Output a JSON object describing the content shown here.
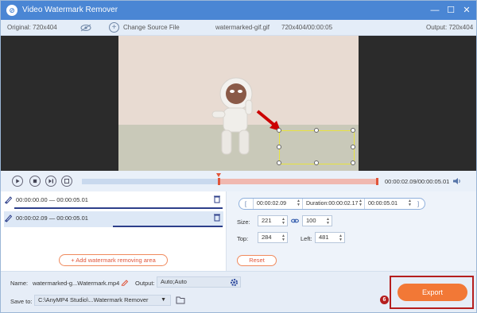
{
  "app": {
    "title": "Video Watermark Remover"
  },
  "infobar": {
    "original": "Original: 720x404",
    "change_source": "Change Source File",
    "filename": "watermarked-gif.gif",
    "dimensions_duration": "720x404/00:00:05",
    "output": "Output: 720x404"
  },
  "timeline": {
    "time": "00:00:02.09/00:00:05.01"
  },
  "clips": [
    {
      "label": "00:00:00.00 — 00:00:05.01"
    },
    {
      "label": "00:00:02.09 — 00:00:05.01"
    }
  ],
  "add_area_label": "Add watermark removing area",
  "range": {
    "open_bracket": "[",
    "start": "00:00:02.09",
    "duration": "Duration:00:00:02.17",
    "end": "00:00:05.01",
    "close_bracket": "]"
  },
  "size": {
    "label": "Size:",
    "width": "221",
    "height": "100"
  },
  "position": {
    "top_label": "Top:",
    "top": "284",
    "left_label": "Left:",
    "left": "481"
  },
  "reset_label": "Reset",
  "footer": {
    "name_label": "Name:",
    "name_value": "watermarked-g...Watermark.mp4",
    "output_label": "Output:",
    "output_value": "Auto;Auto",
    "save_label": "Save to:",
    "save_path": "C:\\AnyMP4 Studio\\...Watermark Remover",
    "export_label": "Export",
    "step_badge": "6"
  },
  "colors": {
    "titlebar": "#4a86d4",
    "accent": "#f27836",
    "highlight": "#b51e1e",
    "selection": "#e8e340"
  }
}
